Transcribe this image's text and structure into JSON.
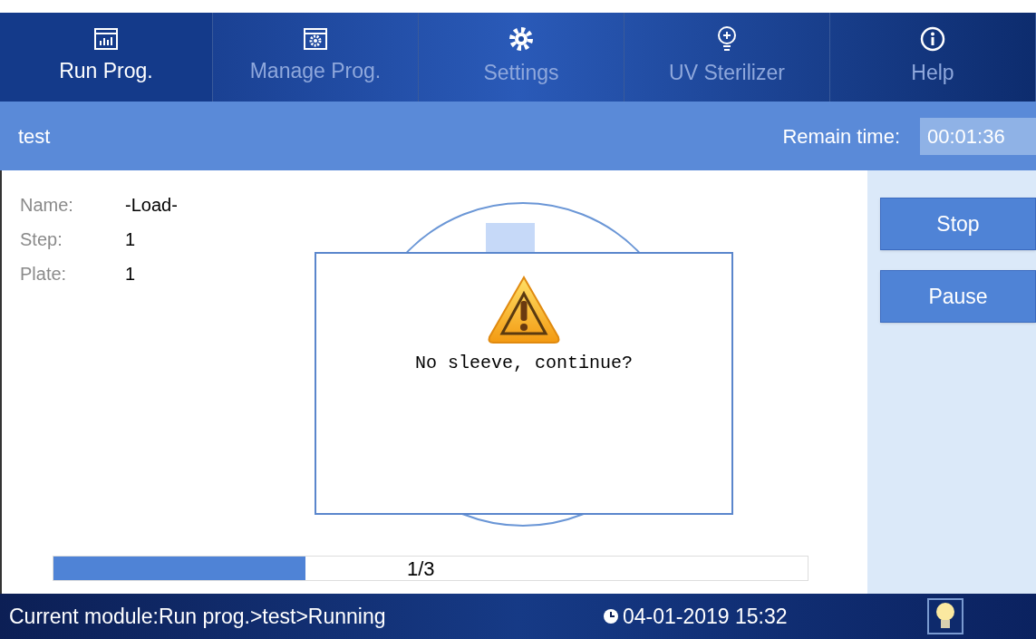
{
  "tabs": [
    {
      "label": "Run Prog.",
      "selected": true
    },
    {
      "label": "Manage Prog.",
      "selected": false
    },
    {
      "label": "Settings",
      "selected": false
    },
    {
      "label": "UV Sterilizer",
      "selected": false
    },
    {
      "label": "Help",
      "selected": false
    }
  ],
  "header": {
    "program": "test",
    "remain_label": "Remain time:",
    "remain_value": "00:01:36"
  },
  "details": [
    {
      "label": "Name:",
      "value": "-Load-"
    },
    {
      "label": "Step:",
      "value": "1"
    },
    {
      "label": "Plate:",
      "value": "1"
    }
  ],
  "dialog": {
    "message": "No sleeve, continue?"
  },
  "progress": {
    "level": 0.334,
    "reading": "1/3"
  },
  "buttons": [
    "Stop",
    "Pause"
  ],
  "status_bar": {
    "module": "Current module:Run prog.>test>Running",
    "datetime": "04-01-2019 15:32"
  }
}
